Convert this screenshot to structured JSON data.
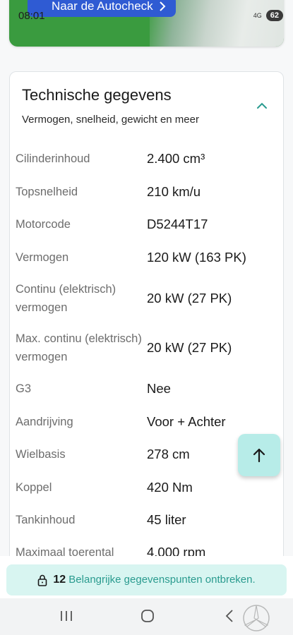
{
  "banner": {
    "cta_label": "Naar de Autocheck",
    "cta_icon": "chevron-right-icon"
  },
  "status_bar": {
    "time": "08:01",
    "network": "4G",
    "battery": "62"
  },
  "card": {
    "title": "Technische gegevens",
    "subtitle": "Vermogen, snelheid, gewicht en meer",
    "toggle_icon": "chevron-up-icon",
    "rows": [
      {
        "label": "Cilinderinhoud",
        "value": "2.400 cm³"
      },
      {
        "label": "Topsnelheid",
        "value": "210 km/u"
      },
      {
        "label": "Motorcode",
        "value": "D5244T17"
      },
      {
        "label": "Vermogen",
        "value": "120 kW (163 PK)"
      },
      {
        "label": "Continu (elektrisch) vermogen",
        "value": "20 kW (27 PK)"
      },
      {
        "label": "Max. continu (elektrisch) vermogen",
        "value": "20 kW (27 PK)"
      },
      {
        "label": "G3",
        "value": "Nee"
      },
      {
        "label": "Aandrijving",
        "value": "Voor + Achter"
      },
      {
        "label": "Wielbasis",
        "value": "278 cm"
      },
      {
        "label": "Koppel",
        "value": "420 Nm"
      },
      {
        "label": "Tankinhoud",
        "value": "45 liter"
      },
      {
        "label": "Maximaal toerental",
        "value": "4.000 rpm"
      }
    ]
  },
  "fab": {
    "icon": "arrow-up-icon"
  },
  "notice": {
    "icon": "lock-icon",
    "count": "12",
    "text": "Belangrijke gegevenspunten ontbreken."
  },
  "navbar": {
    "recent_icon": "recent-apps-icon",
    "home_icon": "home-icon",
    "back_icon": "back-icon"
  },
  "colors": {
    "accent": "#2a9b8f",
    "fab_bg": "#b7ece8",
    "notice_bg": "#d8f5f1",
    "cta_bg": "#2f5bd3",
    "banner_green": "#3a9b3f"
  }
}
